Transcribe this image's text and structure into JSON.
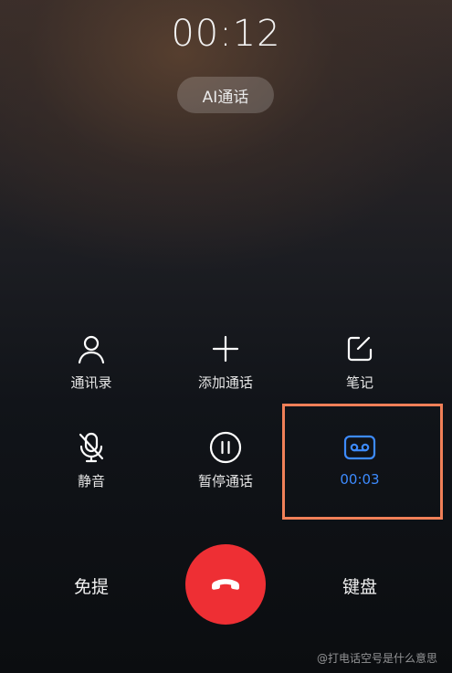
{
  "call": {
    "timer": "00:12",
    "ai_button": "AI通话"
  },
  "controls": {
    "contacts": {
      "label": "通讯录",
      "icon": "person-icon"
    },
    "add_call": {
      "label": "添加通话",
      "icon": "plus-icon"
    },
    "notes": {
      "label": "笔记",
      "icon": "note-edit-icon"
    },
    "mute": {
      "label": "静音",
      "icon": "mic-off-icon"
    },
    "hold": {
      "label": "暂停通话",
      "icon": "pause-icon"
    },
    "recording": {
      "label": "00:03",
      "icon": "recorder-icon",
      "color": "#3d8bff"
    }
  },
  "bottom": {
    "speaker": "免提",
    "keypad": "键盘",
    "hangup_icon": "hang-up-icon",
    "hangup_color": "#ee2f34"
  },
  "highlight_color": "#f08058",
  "watermark": "@打电话空号是什么意思"
}
